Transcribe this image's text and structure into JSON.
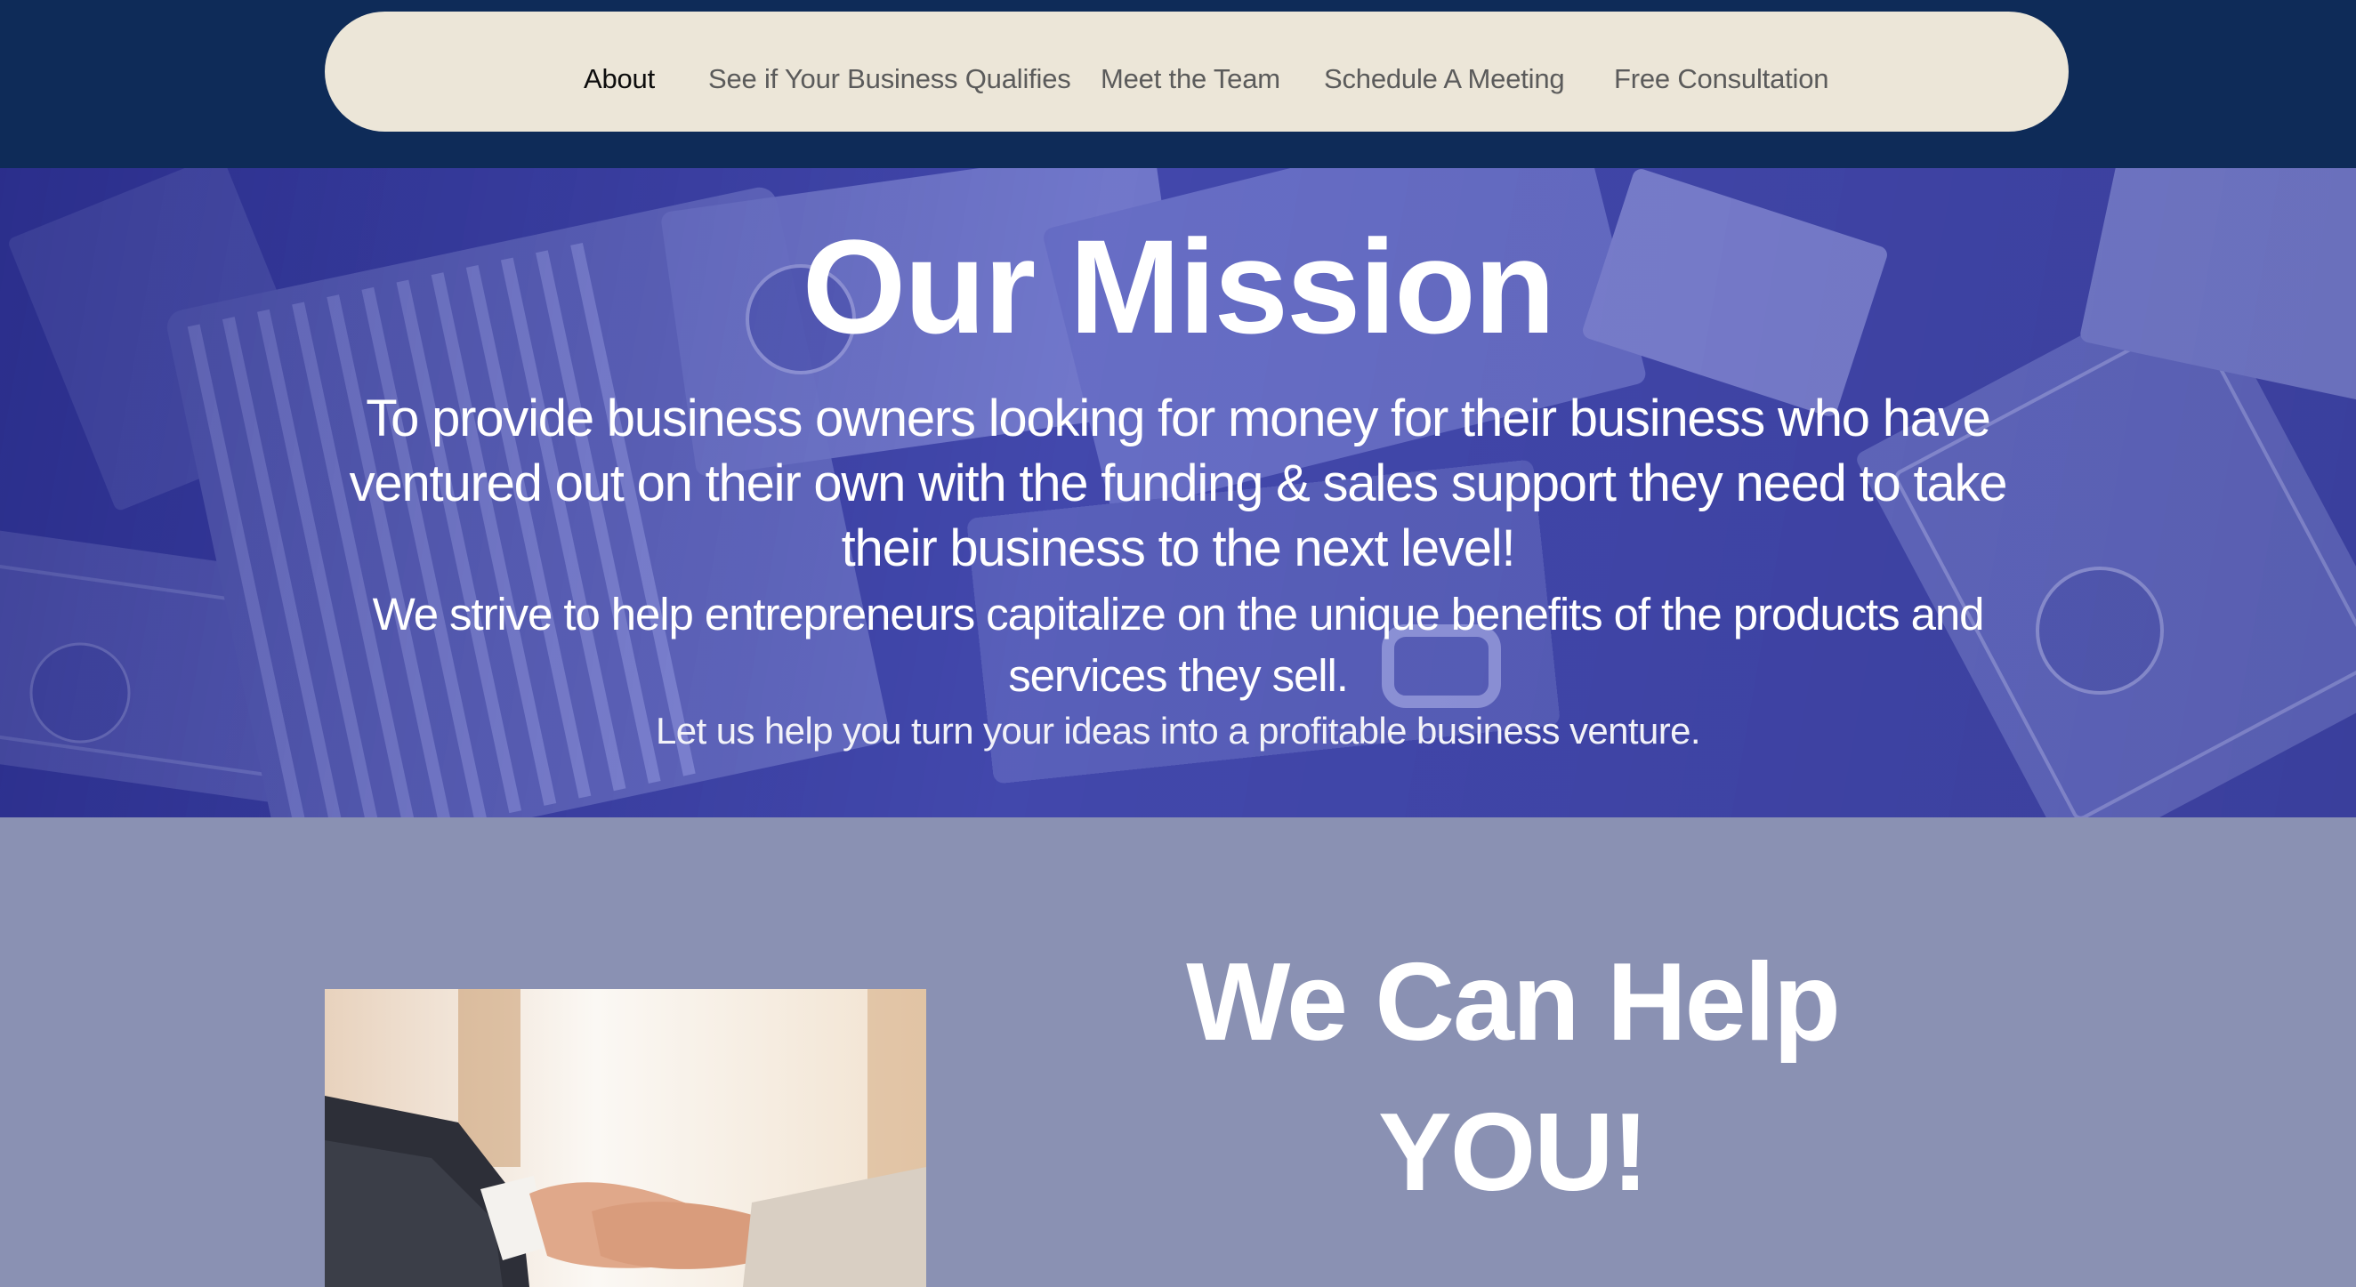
{
  "nav": {
    "items": [
      {
        "label": "About",
        "active": true
      },
      {
        "label": "See if Your Business Qualifies",
        "active": false
      },
      {
        "label": "Meet the Team",
        "active": false
      },
      {
        "label": "Schedule A Meeting",
        "active": false
      },
      {
        "label": "Free Consultation",
        "active": false
      }
    ]
  },
  "hero": {
    "title": "Our Mission",
    "paragraph1": "To provide business owners looking for money for their business who have ventured out on their own with the funding & sales support they need to take their business to the next level!",
    "paragraph2": "We strive to help entrepreneurs capitalize on the unique benefits of the products and services they sell.",
    "paragraph3": "Let us help you turn your ideas into a profitable business venture.",
    "background_image": "briefcase of dollar bills"
  },
  "section": {
    "heading_line1": "We Can Help",
    "heading_line2": "YOU!",
    "image": "business handshake"
  },
  "colors": {
    "topbar": "#0e2b58",
    "nav_pill": "#ece6d8",
    "hero_tint": "#3b3f9a",
    "section_bg": "#8a91b3",
    "text_light": "#ffffff"
  }
}
